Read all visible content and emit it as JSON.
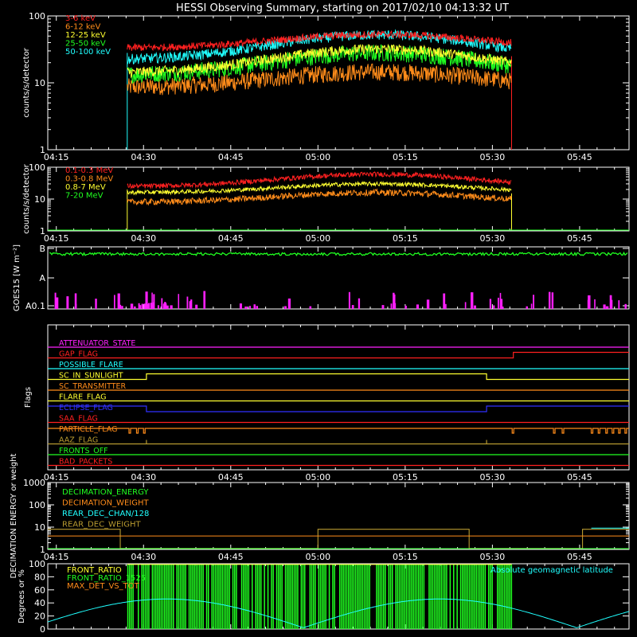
{
  "title": "HESSI Observing Summary, starting on 2017/02/10 04:13:32 UT",
  "colors": {
    "red": "#ff2020",
    "orange": "#ff8c1a",
    "yellow": "#ffff30",
    "green": "#20ff20",
    "cyan": "#20ffff",
    "magenta": "#ff20ff",
    "blue": "#3030ff",
    "olive": "#b89a30",
    "white": "#ffffff"
  },
  "chart_data": [
    {
      "id": "hxr",
      "type": "line",
      "ylabel": "counts/s/detector",
      "y_scale": "log",
      "ylim": [
        1,
        100
      ],
      "y_ticks": [
        {
          "v": 1,
          "label": "1"
        },
        {
          "v": 10,
          "label": "10"
        },
        {
          "v": 100,
          "label": "100"
        }
      ],
      "x_tick_labels": [
        "04:15",
        "04:30",
        "04:45",
        "05:00",
        "05:15",
        "05:30",
        "05:45"
      ],
      "series": [
        {
          "name": "3-6 keV",
          "color": "red"
        },
        {
          "name": "6-12 keV",
          "color": "orange"
        },
        {
          "name": "12-25 keV",
          "color": "yellow"
        },
        {
          "name": "25-50 keV",
          "color": "green"
        },
        {
          "name": "50-100 keV",
          "color": "cyan"
        }
      ]
    },
    {
      "id": "gamma",
      "type": "line",
      "ylabel": "counts/s/detector",
      "y_scale": "log",
      "ylim": [
        1,
        100
      ],
      "y_ticks": [
        {
          "v": 1,
          "label": "1"
        },
        {
          "v": 10,
          "label": "10"
        },
        {
          "v": 100,
          "label": "100"
        }
      ],
      "x_tick_labels": [
        "04:15",
        "04:30",
        "04:45",
        "05:00",
        "05:15",
        "05:30",
        "05:45"
      ],
      "series": [
        {
          "name": "0.1-0.3 MeV",
          "color": "red"
        },
        {
          "name": "0.3-0.8 MeV",
          "color": "orange"
        },
        {
          "name": "0.8-7 MeV",
          "color": "yellow"
        },
        {
          "name": "7-20 MeV",
          "color": "green"
        }
      ]
    },
    {
      "id": "goes",
      "type": "line",
      "ylabel": "GOES15 [W m⁻²]",
      "y_tick_labels": [
        "B",
        "A",
        "A0.1"
      ]
    },
    {
      "id": "flags",
      "type": "line",
      "ylabel": "Flags",
      "x_tick_labels": [
        "04:15",
        "04:30",
        "04:45",
        "05:00",
        "05:15",
        "05:30",
        "05:45"
      ],
      "series": [
        {
          "name": "ATTENUATOR_STATE",
          "color": "magenta"
        },
        {
          "name": "GAP_FLAG",
          "color": "red"
        },
        {
          "name": "POSSIBLE_FLARE",
          "color": "cyan"
        },
        {
          "name": "SC_IN_SUNLIGHT",
          "color": "yellow"
        },
        {
          "name": "SC_TRANSMITTER",
          "color": "orange"
        },
        {
          "name": "FLARE_FLAG",
          "color": "yellow"
        },
        {
          "name": "ECLIPSE_FLAG",
          "color": "blue"
        },
        {
          "name": "SAA_FLAG",
          "color": "red"
        },
        {
          "name": "PARTICLE_FLAG",
          "color": "orange"
        },
        {
          "name": "AAZ_FLAG",
          "color": "olive"
        },
        {
          "name": "FRONTS_OFF",
          "color": "green"
        },
        {
          "name": "BAD_PACKETS",
          "color": "red"
        }
      ]
    },
    {
      "id": "decim",
      "type": "line",
      "ylabel": "DECIMATION ENERGY or weight",
      "y_scale": "log",
      "ylim": [
        1,
        1000
      ],
      "y_ticks": [
        {
          "v": 1,
          "label": "1"
        },
        {
          "v": 10,
          "label": "10"
        },
        {
          "v": 100,
          "label": "100"
        },
        {
          "v": 1000,
          "label": "1000"
        }
      ],
      "x_tick_labels": [
        "04:15",
        "04:30",
        "04:45",
        "05:00",
        "05:15",
        "05:30",
        "05:45"
      ],
      "series": [
        {
          "name": "DECIMATION_ENERGY",
          "color": "green"
        },
        {
          "name": "DECIMATION_WEIGHT",
          "color": "orange"
        },
        {
          "name": "REAR_DEC_CHAN/128",
          "color": "cyan"
        },
        {
          "name": "REAR_DEC_WEIGHT",
          "color": "olive"
        }
      ]
    },
    {
      "id": "ratio",
      "type": "line",
      "ylabel": "Degrees or %",
      "ylim": [
        0,
        100
      ],
      "y_ticks": [
        {
          "v": 0,
          "label": "0"
        },
        {
          "v": 20,
          "label": "20"
        },
        {
          "v": 40,
          "label": "40"
        },
        {
          "v": 60,
          "label": "60"
        },
        {
          "v": 80,
          "label": "80"
        },
        {
          "v": 100,
          "label": "100"
        }
      ],
      "series": [
        {
          "name": "FRONT_RATIO",
          "color": "yellow"
        },
        {
          "name": "FRONT_RATIO_1525",
          "color": "green"
        },
        {
          "name": "MAX_DET_VS_TOT",
          "color": "orange"
        },
        {
          "name": "Absolute geomagnetic latitude",
          "color": "cyan"
        }
      ]
    }
  ]
}
